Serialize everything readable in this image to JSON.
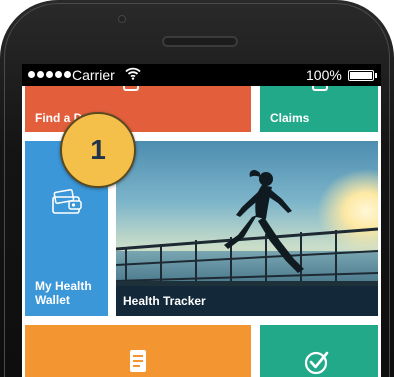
{
  "status_bar": {
    "carrier": "Carrier",
    "battery_percent": "100%",
    "battery_level": 1.0
  },
  "tiles": {
    "find_doctor": {
      "label": "Find a Doctor",
      "color": "#e35f3b"
    },
    "claims": {
      "label": "Claims",
      "color": "#22a98a"
    },
    "wallet": {
      "label": "My Health\nWallet",
      "color": "#3b97d8",
      "icon": "wallet-icon"
    },
    "tracker": {
      "label": "Health Tracker",
      "image": "runner-at-sunset-photo"
    },
    "orange_tile": {
      "color": "#f39531",
      "icon": "document-icon"
    },
    "green_tile": {
      "color": "#22a98a",
      "icon": "checkmark-circle-icon"
    }
  },
  "callout_badge": {
    "number": "1",
    "color": "#f5c04a"
  }
}
